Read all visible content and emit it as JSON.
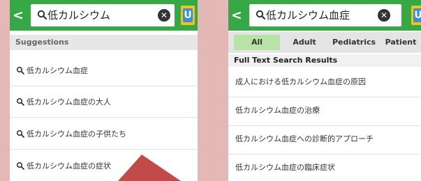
{
  "left": {
    "back_glyph": "<",
    "search_text": "低カルシウム",
    "clear_glyph": "✕",
    "logo_letter": "U",
    "suggestions_label": "Suggestions",
    "suggestions": [
      "低カルシウム血症",
      "低カルシウム血症の大人",
      "低カルシウム血症の子供たち",
      "低カルシウム血症の症状"
    ]
  },
  "right": {
    "back_glyph": "<",
    "search_text": "低カルシウム血症",
    "clear_glyph": "✕",
    "logo_letter": "U",
    "tabs": [
      "All",
      "Adult",
      "Pediatrics",
      "Patient"
    ],
    "active_tab": "All",
    "results_label": "Full Text Search Results",
    "results": [
      "成人における低カルシウム血症の原因",
      "低カルシウム血症の治療",
      "低カルシウム血症への診断的アプローチ",
      "低カルシウム血症の臨床症状"
    ]
  },
  "colors": {
    "header_green": "#36a845",
    "active_tab": "#b7e4a6",
    "background": "#e5b8b8",
    "pointer": "#c34a4a"
  },
  "icons": [
    "back-icon",
    "search-icon",
    "clear-icon",
    "uptodate-logo-icon"
  ]
}
